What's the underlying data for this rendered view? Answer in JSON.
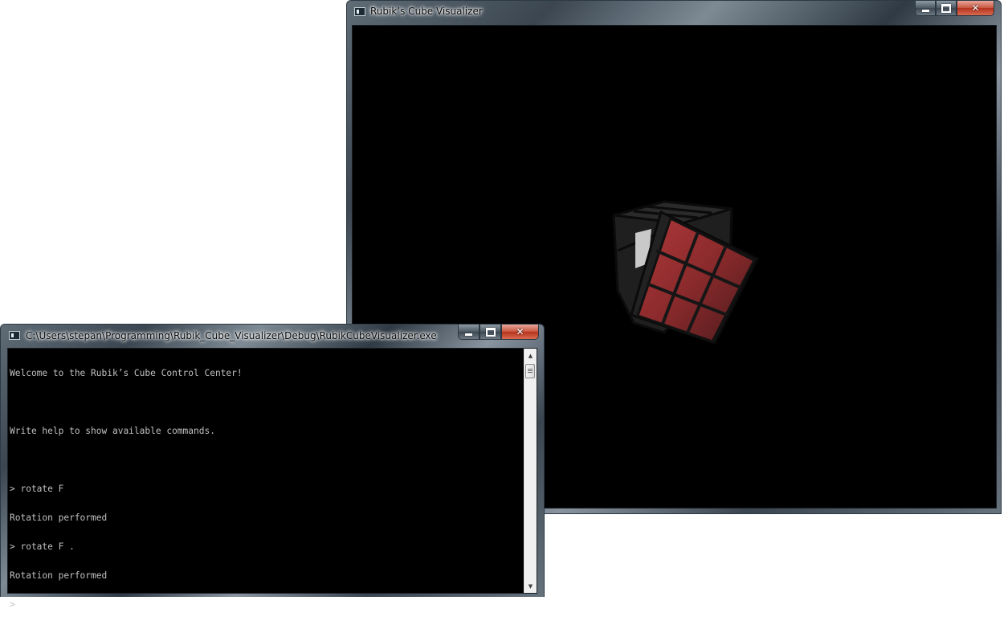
{
  "visualizer_window": {
    "title": "Rubik’s Cube Visualizer",
    "cube": {
      "visible_face_color": "#b22f2f",
      "grid": "3x3",
      "front_rotated": true
    }
  },
  "console_window": {
    "title": "C:\\Users\\stepan\\Programming\\Rubik_Cube_Visualizer\\Debug\\RubikCubeVisualizer.exe",
    "lines": [
      "Welcome to the Rubik’s Cube Control Center!",
      "",
      "Write help to show available commands.",
      "",
      "> rotate F",
      "Rotation performed",
      "> rotate F .",
      "Rotation performed",
      ">"
    ]
  },
  "icons": {
    "minimize": "minimize-icon",
    "maximize": "maximize-icon",
    "close": "close-icon",
    "app": "console-app-icon",
    "scroll_up": "scroll-up-arrow-icon",
    "scroll_down": "scroll-down-arrow-icon"
  },
  "colors": {
    "console_bg": "#000000",
    "console_text": "#c0c0c0",
    "close_button": "#c8553e"
  }
}
